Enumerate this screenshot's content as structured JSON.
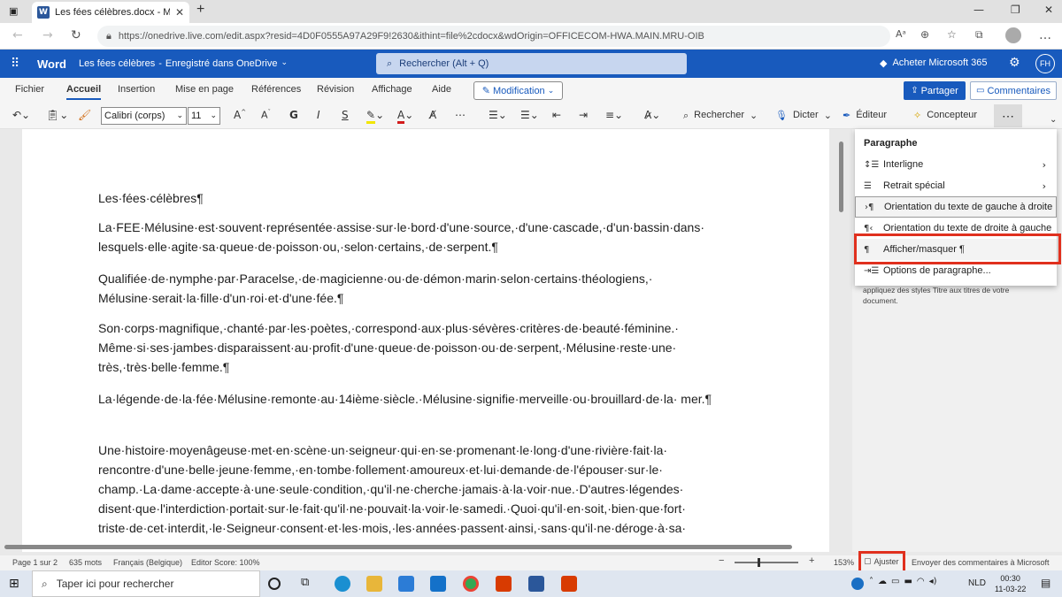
{
  "browser": {
    "tab_title": "Les fées célèbres.docx - Microsof",
    "url": "https://onedrive.live.com/edit.aspx?resid=4D0F0555A97A29F9!2630&ithint=file%2cdocx&wdOrigin=OFFICECOM-HWA.MAIN.MRU-OIB"
  },
  "word_header": {
    "app_name": "Word",
    "doc_title": "Les fées célèbres",
    "save_status": "Enregistré dans OneDrive",
    "search_placeholder": "Rechercher (Alt + Q)",
    "buy": "Acheter Microsoft 365",
    "avatar_initials": "FH"
  },
  "ribbon_tabs": [
    "Fichier",
    "Accueil",
    "Insertion",
    "Mise en page",
    "Références",
    "Révision",
    "Affichage",
    "Aide"
  ],
  "mode_button": "Modification",
  "share_button": "Partager",
  "comments_button": "Commentaires",
  "toolbar": {
    "font": "Calibri (corps)",
    "font_size": "11",
    "find": "Rechercher",
    "dictate": "Dicter",
    "editor": "Éditeur",
    "designer": "Concepteur"
  },
  "document": {
    "paragraphs": [
      "Les·fées·célèbres¶",
      "La·FEE·Mélusine·est·souvent·représentée·assise·sur·le·bord·d'une·source,·d'une·cascade,·d'un·bassin·dans· lesquels·elle·agite·sa·queue·de·poisson·ou,·selon·certains,·de·serpent.¶",
      "Qualifiée·de·nymphe·par·Paracelse,·de·magicienne·ou·de·démon·marin·selon·certains·théologiens,· Mélusine·serait·la·fille·d'un·roi·et·d'une·fée.¶",
      "Son·corps·magnifique,·chanté·par·les·poètes,·correspond·aux·plus·sévères·critères·de·beauté·féminine.· Même·si·ses·jambes·disparaissent·au·profit·d'une·queue·de·poisson·ou·de·serpent,·Mélusine·reste·une· très,·très·belle·femme.¶",
      "La·légende·de·la·fée·Mélusine·remonte·au·14ième·siècle.·Mélusine·signifie·merveille·ou·brouillard·de·la· mer.¶",
      "Une·histoire·moyenâgeuse·met·en·scène·un·seigneur·qui·en·se·promenant·le·long·d'une·rivière·fait·la· rencontre·d'une·belle·jeune·femme,·en·tombe·follement·amoureux·et·lui·demande·de·l'épouser·sur·le· champ.·La·dame·accepte·à·une·seule·condition,·qu'il·ne·cherche·jamais·à·la·voir·nue.·D'autres·légendes· disent·que·l'interdiction·portait·sur·le·fait·qu'il·ne·pouvait·la·voir·le·samedi.·Quoi·qu'il·en·soit,·bien·que·fort· triste·de·cet·interdit,·le·Seigneur·consent·et·les·mois,·les·années·passent·ainsi,·sans·qu'il·ne·déroge·à·sa·"
    ]
  },
  "paragraph_menu": {
    "title": "Paragraphe",
    "items": [
      {
        "label": "Interligne",
        "icon": "line-spacing-icon"
      },
      {
        "label": "Retrait spécial",
        "icon": "indent-icon"
      },
      {
        "label": "Orientation du texte de gauche à droite",
        "icon": "ltr-icon"
      },
      {
        "label": "Orientation du texte de droite à gauche",
        "icon": "rtl-icon"
      },
      {
        "label": "Afficher/masquer ¶",
        "icon": "pilcrow-icon"
      },
      {
        "label": "Options de paragraphe...",
        "icon": "paragraph-options-icon"
      }
    ],
    "hint": "appliquez des styles Titre aux titres de votre document."
  },
  "status_bar": {
    "page": "Page 1 sur 2",
    "words": "635 mots",
    "language": "Français (Belgique)",
    "editor_score": "Editor Score: 100%",
    "zoom": "153%",
    "fit": "Ajuster",
    "feedback": "Envoyer des commentaires à Microsoft"
  },
  "taskbar": {
    "search_placeholder": "Taper ici pour rechercher",
    "lang": "NLD",
    "time": "00:30",
    "date": "11-03-22"
  },
  "colors": {
    "word_blue": "#185abd",
    "highlight_red": "#e0301e"
  }
}
